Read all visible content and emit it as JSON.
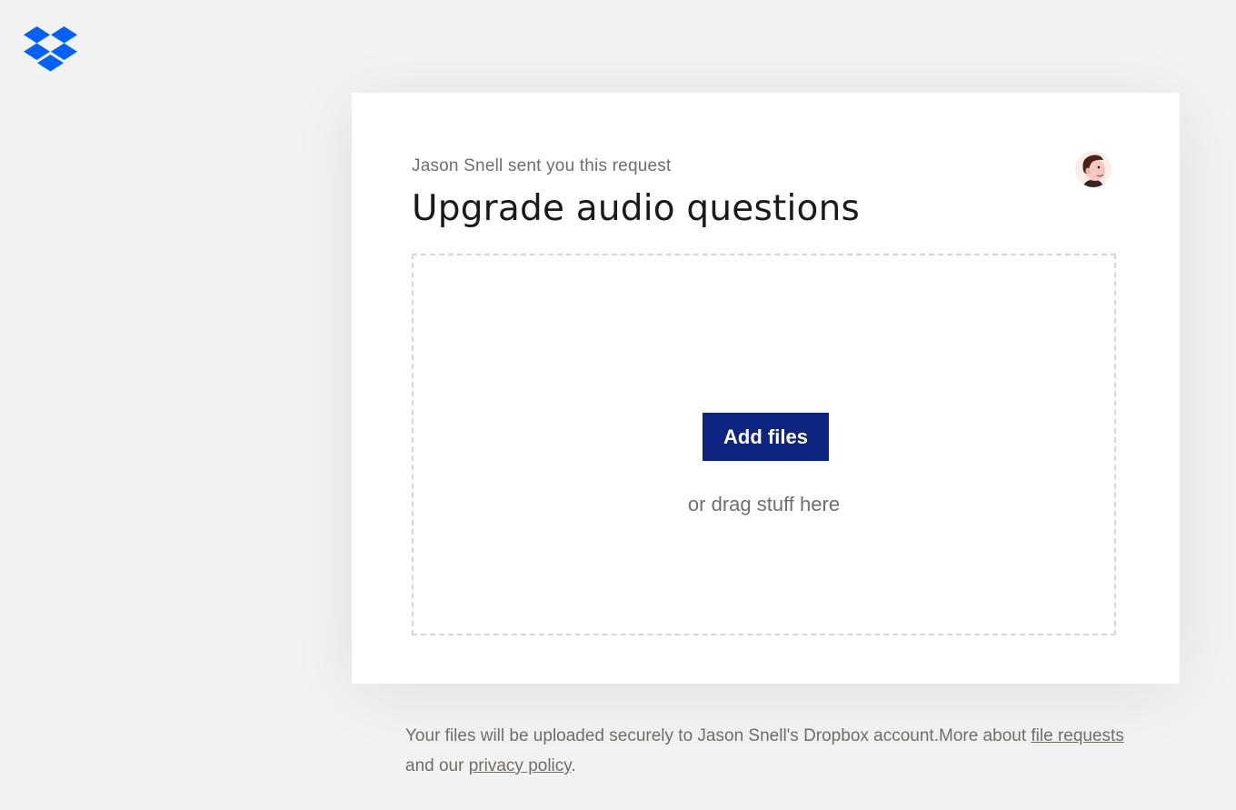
{
  "brand": {
    "logo_icon": "dropbox-logo-icon",
    "color": "#0061fe"
  },
  "request": {
    "sender_text": "Jason Snell sent you this request",
    "title": "Upgrade audio questions",
    "avatar_icon": "avatar-portrait-icon"
  },
  "dropzone": {
    "button_label": "Add files",
    "button_color": "#0d2481",
    "drag_text": "or drag stuff here"
  },
  "footer": {
    "text_before": "Your files will be uploaded securely to Jason Snell's Dropbox account.More about ",
    "link_file_requests": "file requests",
    "text_middle": " and our ",
    "link_privacy": "privacy policy",
    "text_end": "."
  }
}
